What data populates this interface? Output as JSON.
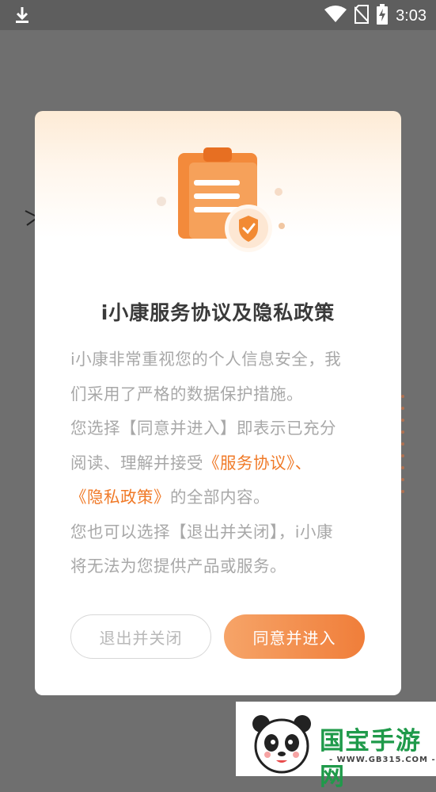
{
  "status_bar": {
    "time": "3:03",
    "icons": [
      "download-icon",
      "wifi-icon",
      "no-sim-icon",
      "battery-charging-icon"
    ]
  },
  "dialog": {
    "title": "i小康服务协议及隐私政策",
    "body": {
      "line1": "i小康非常重视您的个人信息安全，我",
      "line2": "们采用了严格的数据保护措施。",
      "line3": "您选择【同意并进入】即表示已充分",
      "line4_prefix": "阅读、理解并接受",
      "link_service": "《服务协议》",
      "separator": "、",
      "link_privacy": "《隐私政策》",
      "line5_suffix": "的全部内容。",
      "line6": "您也可以选择【退出并关闭】，i小康",
      "line7": "将无法为您提供产品或服务。"
    },
    "buttons": {
      "exit_label": "退出并关闭",
      "agree_label": "同意并进入"
    },
    "colors": {
      "accent": "#f07a28",
      "button_gradient_start": "#f6a468",
      "button_gradient_end": "#f07e3a",
      "title": "#3a3a3a",
      "body_text": "#a8a8a8"
    }
  },
  "watermark": {
    "text": "国宝手游网",
    "url": "- WWW.GB315.COM -"
  }
}
